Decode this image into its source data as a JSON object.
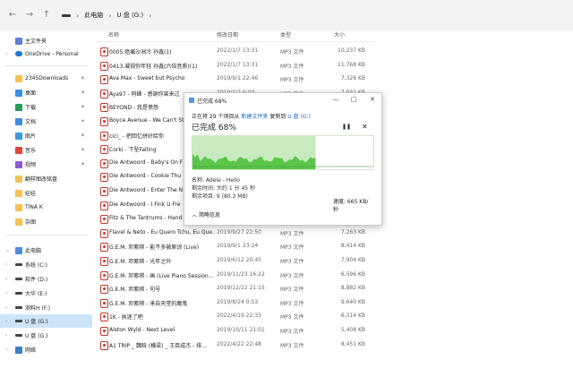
{
  "address": {
    "crumbs": [
      "此电脑",
      "U 盘 (G:)"
    ]
  },
  "sidebar": {
    "items": [
      {
        "label": "主文件夹",
        "icon": "home-icon"
      },
      {
        "label": "OneDrive - Personal",
        "icon": "cloud-icon"
      },
      {
        "label": "2345Downloads",
        "icon": "folder-icon"
      },
      {
        "label": "桌面",
        "icon": "desktop-icon"
      },
      {
        "label": "下载",
        "icon": "download-icon"
      },
      {
        "label": "文档",
        "icon": "documents-icon"
      },
      {
        "label": "图片",
        "icon": "pictures-icon"
      },
      {
        "label": "音乐",
        "icon": "music-icon"
      },
      {
        "label": "视频",
        "icon": "videos-icon"
      },
      {
        "label": "翻样图改铭盘",
        "icon": "folder-icon"
      },
      {
        "label": "娃娃",
        "icon": "folder-icon"
      },
      {
        "label": "TINA K",
        "icon": "folder-icon"
      },
      {
        "label": "杂图",
        "icon": "folder-icon"
      },
      {
        "label": "此电脑",
        "icon": "pc-icon"
      },
      {
        "label": "系统 (C:)",
        "icon": "drive-icon"
      },
      {
        "label": "软件 (D:)",
        "icon": "drive-icon"
      },
      {
        "label": "大华 (E:)",
        "icon": "drive-icon"
      },
      {
        "label": "测料H (F:)",
        "icon": "drive-icon"
      },
      {
        "label": "U 盘 (G:)",
        "icon": "drive-icon"
      },
      {
        "label": "U 盘 (G:)",
        "icon": "drive-icon"
      },
      {
        "label": "网络",
        "icon": "network-icon"
      }
    ]
  },
  "columns": {
    "name": "名称",
    "date": "修改日期",
    "type": "类型",
    "size": "大小"
  },
  "files": [
    {
      "name": "0005.癌痛沙洲冷 孙鑫(1)",
      "date": "2022/1/7 13:31",
      "type": "MP3 文件",
      "size": "10,237 KB"
    },
    {
      "name": "0413.凝视你年轻 孙鑫(六倍音质)(1)",
      "date": "2022/1/7 13:31",
      "type": "MP3 文件",
      "size": "11,768 KB"
    },
    {
      "name": "Ava Max - Sweet but Psycho",
      "date": "2019/9/1 22:46",
      "type": "MP3 文件",
      "size": "7,326 KB"
    },
    {
      "name": "Aya97 - 阿峰 - 感谢你曾来过",
      "date": "2019/3/2 0:03",
      "type": "MP3 文件",
      "size": "7,931 KB"
    },
    {
      "name": "BEYOND - 我是愤怒",
      "date": "",
      "type": "",
      "size": ""
    },
    {
      "name": "Boyce Avenue - We Can't St",
      "date": "",
      "type": "",
      "size": ""
    },
    {
      "name": "cici_ - 把回忆拼好给你",
      "date": "",
      "type": "",
      "size": ""
    },
    {
      "name": "Corki - 下坠Falling",
      "date": "",
      "type": "",
      "size": ""
    },
    {
      "name": "Die Antwoord - Baby's On F",
      "date": "",
      "type": "",
      "size": ""
    },
    {
      "name": "Die Antwoord - Cookie Thu",
      "date": "",
      "type": "",
      "size": ""
    },
    {
      "name": "Die Antwoord - Enter The N",
      "date": "",
      "type": "",
      "size": ""
    },
    {
      "name": "Die Antwoord - I Fink U Fre",
      "date": "",
      "type": "",
      "size": ""
    },
    {
      "name": "Fitz & The Tantrums - Hand",
      "date": "",
      "type": "",
      "size": ""
    },
    {
      "name": "Flavel & Neto - Eu Quero Tchu, Eu Que...",
      "date": "2019/9/27 22:50",
      "type": "MP3 文件",
      "size": "7,263 KB"
    },
    {
      "name": "G.E.M. 邓紫棋 - 能不多被原谅 (Live)",
      "date": "2019/9/1 23:24",
      "type": "MP3 文件",
      "size": "8,414 KB"
    },
    {
      "name": "G.E.M. 邓紫棋 - 光年之外",
      "date": "2019/6/12 20:45",
      "type": "MP3 文件",
      "size": "7,904 KB"
    },
    {
      "name": "G.E.M. 邓紫棋 - 画 (Live Piano Session...",
      "date": "2019/11/23 16:22",
      "type": "MP3 文件",
      "size": "6,596 KB"
    },
    {
      "name": "G.E.M. 邓紫棋 - 句号",
      "date": "2019/12/22 21:15",
      "type": "MP3 文件",
      "size": "8,882 KB"
    },
    {
      "name": "G.E.M. 邓紫棋 - 来自天堂的魔鬼",
      "date": "2019/8/24 0:53",
      "type": "MP3 文件",
      "size": "9,640 KB"
    },
    {
      "name": "1K - 执迷了吧",
      "date": "2022/4/19 22:33",
      "type": "MP3 文件",
      "size": "6,314 KB"
    },
    {
      "name": "Alston Wyld - Next Level",
      "date": "2019/10/11 21:01",
      "type": "MP3 文件",
      "size": "5,408 KB"
    },
    {
      "name": "A1 TRIP _ 魏晗 (横梁) _ 王目成杰 - 绯...",
      "date": "2022/4/22 22:48",
      "type": "MP3 文件",
      "size": "8,451 KB"
    }
  ],
  "dialog": {
    "title": "已完成 68%",
    "copy_prefix": "正在将 29 个项目从",
    "source": "新建文件夹",
    "copy_mid": "复制到",
    "dest": "U 盘 (G:)",
    "percent_label": "已完成 68%",
    "progress": 0.68,
    "speed": "速度: 665 KB/秒",
    "name_line": "名称: Adele - Hello",
    "time_line": "剩余时间: 大约 1 分 45 秒",
    "items_line": "剩余项目: 9 (80.3 MB)",
    "details": "简略信息",
    "accent_fill": "#5cc64b",
    "accent_light": "#c8eabf"
  }
}
